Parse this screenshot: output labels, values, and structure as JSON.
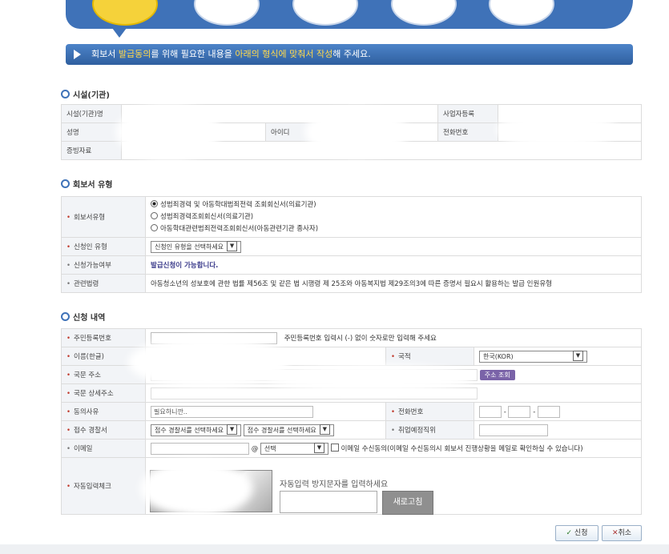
{
  "banner": {
    "pre": "회보서 ",
    "highlight1": "발급동의",
    "mid": "를 위해 필요한 내용을 ",
    "highlight2": "아래의 형식에 맞춰서 작성",
    "post": "해 주세요."
  },
  "section_facility": {
    "title": "시설(기관)",
    "facility_name_label": "시설(기관)명",
    "business_no_label": "사업자등록",
    "name_label": "성명",
    "id_label": "아이디",
    "phone_label": "전화번호",
    "proof_label": "증빙자료"
  },
  "section_type": {
    "title": "회보서 유형",
    "type_label": "회보서유형",
    "options": [
      "성범죄경력 및 아동학대범죄전력 조회회신서(의료기관)",
      "성범죄경력조회회신서(의료기관)",
      "아동학대관련범죄전력조회회신서(아동관련기관 종사자)"
    ],
    "applicant_type_label": "신청인 유형",
    "applicant_type_select": "신청인 유형을 선택하세요",
    "availability_label": "신청가능여부",
    "availability_value": "발급신청이 가능합니다.",
    "law_label": "관련법령",
    "law_value": "아동청소년의 성보호에 관한 법률 제56조 및 같은 법 시행령 제 25조와 아동복지법 제29조의3에 따른 증명서 필요시 활용하는 발급 인원유형"
  },
  "section_apply": {
    "title": "신청 내역",
    "rrn_label": "주민등록번호",
    "rrn_hint": "주민등록번호 입력시 (-) 없이 숫자로만 입력해 주세요",
    "name_label": "이름(한글)",
    "nationality_label": "국적",
    "nationality_value": "한국(KOR)",
    "address_label": "국문 주소",
    "address_button": "주소 조회",
    "address_detail_label": "국문 상세주소",
    "reason_label": "동의사유",
    "reason_value": "필요하니깐..",
    "phone_label": "전화번호",
    "phone_sep": "-",
    "police_label": "접수 경찰서",
    "police_select1": "접수 경찰서를 선택하세요",
    "police_select2": "접수 경찰서를 선택하세요",
    "employ_date_label": "취업예정직위",
    "email_label": "이메일",
    "email_at": "@",
    "email_domain_select": "선택",
    "email_consent": "이메일 수신동의(이메일 수신동의시 회보서 진행상황을 메일로 확인하실 수 있습니다)",
    "captcha_label": "자동입력체크",
    "captcha_prompt": "자동입력 방지문자를 입력하세요",
    "refresh_button": "새로고침"
  },
  "actions": {
    "apply_icon": "checkmark-icon",
    "apply_button": "신청",
    "cancel_icon": "close-icon",
    "cancel_button": "취소"
  }
}
